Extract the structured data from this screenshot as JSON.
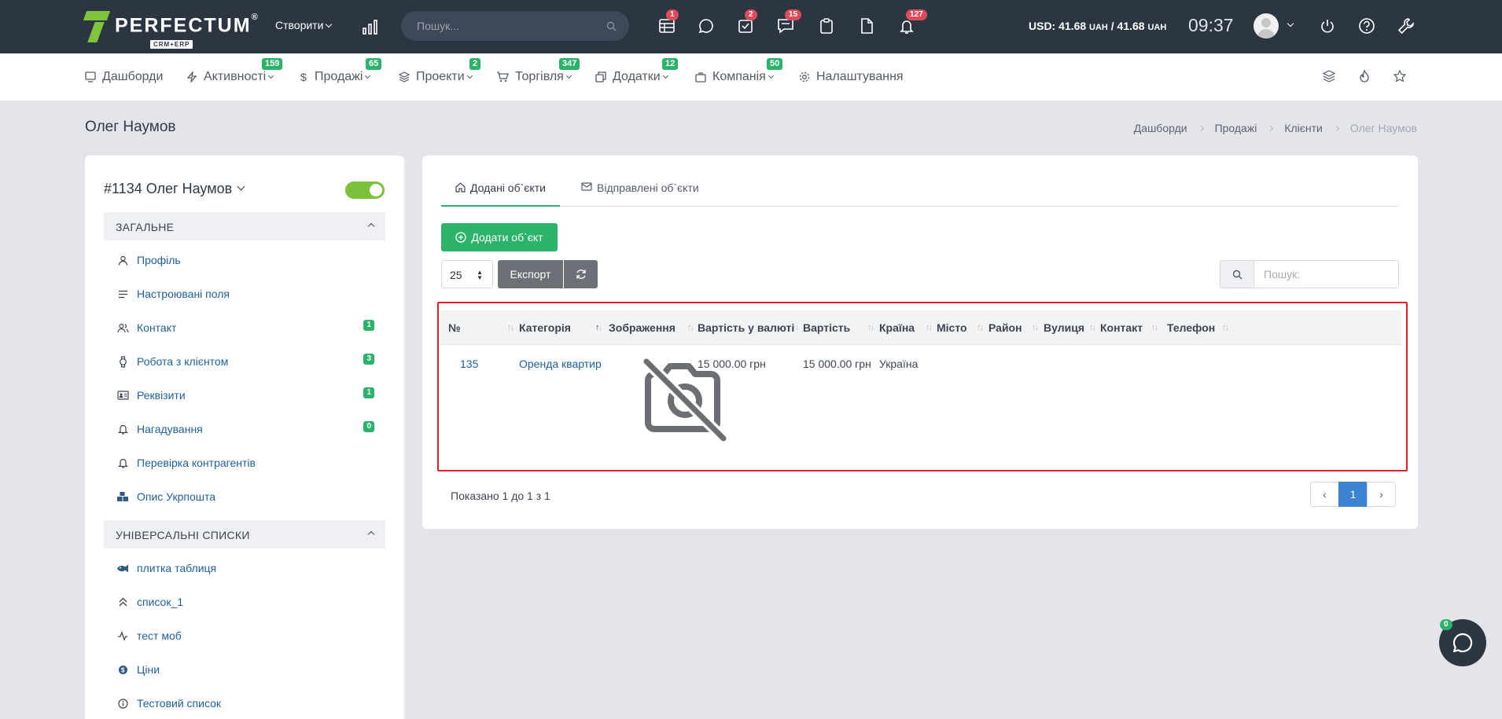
{
  "topbar": {
    "logo_name": "PERFECTUM",
    "logo_reg": "®",
    "logo_sub": "CRM+ERP",
    "create_label": "Створити",
    "search_placeholder": "Пошук...",
    "icons": [
      {
        "name": "tasks-grid-icon",
        "badge": "1"
      },
      {
        "name": "chat-icon",
        "badge": ""
      },
      {
        "name": "checklist-icon",
        "badge": "2"
      },
      {
        "name": "messages-icon",
        "badge": "15"
      },
      {
        "name": "clipboard-icon",
        "badge": ""
      },
      {
        "name": "document-icon",
        "badge": ""
      },
      {
        "name": "bell-icon",
        "badge": "127"
      }
    ],
    "currency_label": "USD: 41.68",
    "currency_unit1": "UAH",
    "currency_sep": " / 41.68",
    "currency_unit2": "UAH",
    "time": "09:37"
  },
  "nav": {
    "items": [
      {
        "label": "Дашборди",
        "badge": ""
      },
      {
        "label": "Активності",
        "badge": "159"
      },
      {
        "label": "Продажі",
        "badge": "65"
      },
      {
        "label": "Проекти",
        "badge": "2"
      },
      {
        "label": "Торгівля",
        "badge": "347"
      },
      {
        "label": "Додатки",
        "badge": "12"
      },
      {
        "label": "Компанія",
        "badge": "50"
      },
      {
        "label": "Налаштування",
        "badge": ""
      }
    ]
  },
  "page": {
    "title": "Олег Наумов",
    "breadcrumb": [
      "Дашборди",
      "Продажі",
      "Клієнти",
      "Олег Наумов"
    ]
  },
  "sidebar": {
    "client": "#1134 Олег Наумов",
    "toggle_on": true,
    "section_general": "ЗАГАЛЬНЕ",
    "general_items": [
      {
        "label": "Профіль",
        "icon": "user-icon",
        "badge": ""
      },
      {
        "label": "Настроювані поля",
        "icon": "lines-icon",
        "badge": ""
      },
      {
        "label": "Контакт",
        "icon": "users-icon",
        "badge": "1"
      },
      {
        "label": "Робота з клієнтом",
        "icon": "watch-icon",
        "badge": "3"
      },
      {
        "label": "Реквізити",
        "icon": "id-card-icon",
        "badge": "1"
      },
      {
        "label": "Нагадування",
        "icon": "bell-icon",
        "badge": "0"
      },
      {
        "label": "Перевірка контрагентів",
        "icon": "bell-icon",
        "badge": ""
      },
      {
        "label": "Опис Укрпошта",
        "icon": "boxes-icon",
        "badge": ""
      }
    ],
    "section_lists": "УНІВЕРСАЛЬНІ СПИСКИ",
    "list_items": [
      {
        "label": "плитка таблиця",
        "icon": "fish-icon"
      },
      {
        "label": "список_1",
        "icon": "double-chevron-up-icon"
      },
      {
        "label": "тест моб",
        "icon": "pulse-icon"
      },
      {
        "label": "Ціни",
        "icon": "coin-icon"
      },
      {
        "label": "Тестовий список",
        "icon": "info-icon"
      }
    ]
  },
  "main": {
    "tabs": [
      {
        "label": "Додані об`єкти",
        "active": true
      },
      {
        "label": "Відправлені об`єкти",
        "active": false
      }
    ],
    "add_button": "Додати об`єкт",
    "page_size": "25",
    "export_button": "Експорт",
    "search_placeholder": "Пошук:",
    "table": {
      "columns": [
        "№",
        "Категорія",
        "Зображення",
        "Вартість у валюті",
        "Вартість",
        "Країна",
        "Місто",
        "Район",
        "Вулиця",
        "Контакт",
        "Телефон"
      ],
      "sorted_column": "Категорія",
      "rows": [
        {
          "num": "135",
          "category": "Оренда квартир",
          "image": "no-image-icon",
          "price_currency": "15 000.00 грн",
          "price": "15 000.00 грн",
          "country": "Україна",
          "city": "",
          "district": "",
          "street": "",
          "contact": "",
          "phone": ""
        }
      ]
    },
    "showing": "Показано 1 до 1 з 1",
    "pagination": {
      "prev": "‹",
      "current": "1",
      "next": "›"
    }
  },
  "chat": {
    "badge": "0"
  },
  "colors": {
    "topbar": "#2c3542",
    "accent_green": "#2bb36a",
    "badge_red": "#e04b59",
    "link_blue": "#1f5f9a",
    "highlight_red": "#e41d2b",
    "page_active": "#3c84d1"
  }
}
